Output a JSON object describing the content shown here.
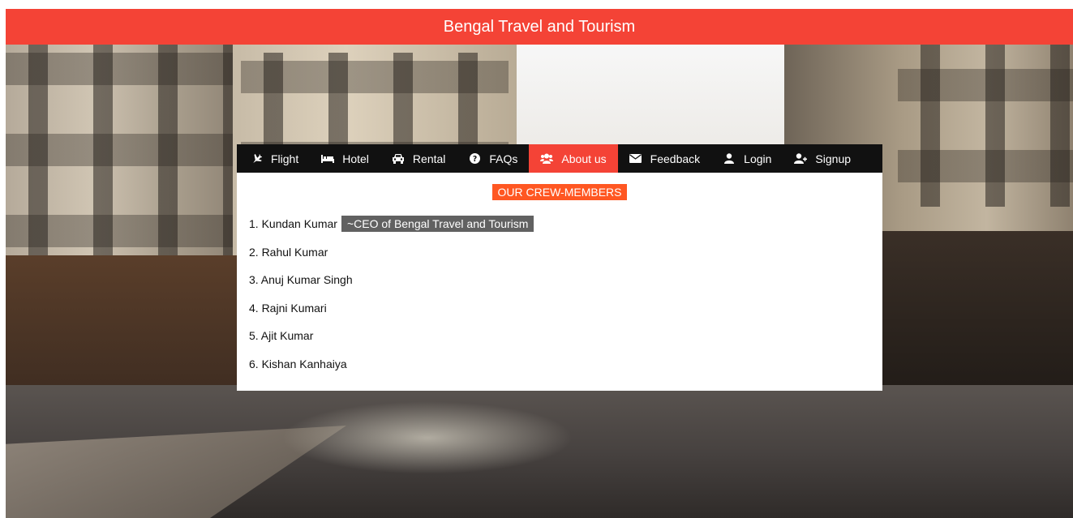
{
  "header": {
    "title": "Bengal Travel and Tourism",
    "color": "#f44336"
  },
  "nav": {
    "items": [
      {
        "label": "Flight",
        "icon": "plane-icon"
      },
      {
        "label": "Hotel",
        "icon": "bed-icon"
      },
      {
        "label": "Rental",
        "icon": "car-icon"
      },
      {
        "label": "FAQs",
        "icon": "question-circle-icon"
      },
      {
        "label": "About us",
        "icon": "users-icon",
        "active": true
      },
      {
        "label": "Feedback",
        "icon": "envelope-icon"
      },
      {
        "label": "Login",
        "icon": "user-icon"
      },
      {
        "label": "Signup",
        "icon": "user-plus-icon"
      }
    ],
    "active_color": "#f44336"
  },
  "crew": {
    "title": "OUR CREW-MEMBERS",
    "title_color": "#ff5722",
    "members": [
      {
        "name": "1. Kundan Kumar",
        "role": "~CEO of Bengal Travel and Tourism"
      },
      {
        "name": "2. Rahul Kumar"
      },
      {
        "name": "3. Anuj Kumar Singh"
      },
      {
        "name": "4. Rajni Kumari"
      },
      {
        "name": "5. Ajit Kumar"
      },
      {
        "name": "6. Kishan Kanhaiya"
      }
    ]
  }
}
